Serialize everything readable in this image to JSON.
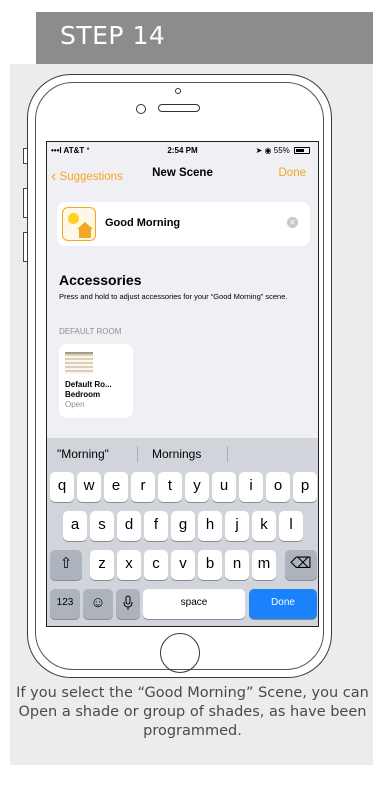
{
  "header": {
    "title": "STEP 14"
  },
  "status_bar": {
    "carrier": "•••l AT&T ᐤ",
    "time": "2:54 PM",
    "battery": "55%"
  },
  "nav": {
    "back_label": "Suggestions",
    "title": "New Scene",
    "done_label": "Done"
  },
  "scene": {
    "name": "Good Morning"
  },
  "accessories": {
    "title": "Accessories",
    "description": "Press and hold to adjust accessories for your “Good Morning” scene.",
    "room_label": "DEFAULT ROOM",
    "tile": {
      "name": "Default Ro...",
      "room": "Bedroom",
      "state": "Open"
    }
  },
  "keyboard": {
    "suggestions": [
      "\"Morning\"",
      "Mornings"
    ],
    "row1": [
      "q",
      "w",
      "e",
      "r",
      "t",
      "y",
      "u",
      "i",
      "o",
      "p"
    ],
    "row2": [
      "a",
      "s",
      "d",
      "f",
      "g",
      "h",
      "j",
      "k",
      "l"
    ],
    "row3": [
      "z",
      "x",
      "c",
      "v",
      "b",
      "n",
      "m"
    ],
    "shift": "⇧",
    "backspace": "⌫",
    "numbers": "123",
    "emoji": "☺",
    "mic": "Ἲ4",
    "space": "space",
    "done": "Done"
  },
  "caption": "If you select the “Good Morning” Scene, you can Open a shade or group of shades, as have been programmed.",
  "colors": {
    "accent": "#f5a623",
    "header_bg": "#8c8c8c",
    "done_key": "#1a82fb"
  }
}
